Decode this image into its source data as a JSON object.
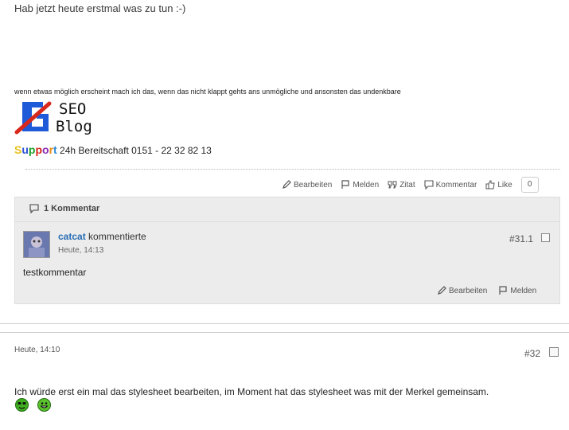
{
  "post1": {
    "text": "Hab jetzt heute erstmal was zu tun :-)",
    "signature": {
      "quote": "wenn etwas möglich erscheint mach ich das, wenn das nicht klappt gehts ans unmögliche und ansonsten das undenkbare",
      "logo_line1": "SEO",
      "logo_line2": "Blog",
      "support_letters": [
        "S",
        "u",
        "p",
        "p",
        "o",
        "r",
        "t"
      ],
      "support_colors": [
        "#e8c21a",
        "#2d4fd6",
        "#1aa12a",
        "#d8271b",
        "#8a2bb5",
        "#e88a12",
        "#2d8bd6"
      ],
      "support_rest": " 24h Bereitschaft 0151 - 22 32 82 13"
    },
    "actions": {
      "edit": "Bearbeiten",
      "report": "Melden",
      "quote": "Zitat",
      "comment": "Kommentar",
      "like": "Like",
      "like_count": "0"
    },
    "comments": {
      "header": "1 Kommentar",
      "items": [
        {
          "author": "catcat",
          "verb": "kommentierte",
          "time": "Heute, 14:13",
          "number": "#31.1",
          "text": "testkommentar",
          "edit": "Bearbeiten",
          "report": "Melden"
        }
      ]
    }
  },
  "post2": {
    "time": "Heute, 14:10",
    "number": "#32",
    "text": "Ich würde erst ein mal das stylesheet bearbeiten, im Moment hat das stylesheet was mit der Merkel gemeinsam.",
    "smileys": [
      "cool-smiley",
      "grin-smiley"
    ]
  }
}
